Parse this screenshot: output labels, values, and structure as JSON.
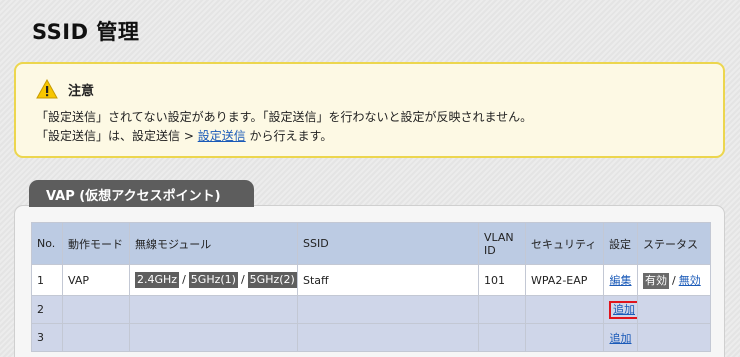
{
  "page": {
    "title": "SSID 管理"
  },
  "notice": {
    "title": "注意",
    "line1": "「設定送信」されてない設定があります。「設定送信」を行わないと設定が反映されません。",
    "line2_prefix": "「設定送信」は、設定送信 > ",
    "line2_link": "設定送信",
    "line2_suffix": " から行えます。",
    "icon": "warning-icon",
    "colors": {
      "background": "#fdf9e4",
      "border": "#ecd64e"
    }
  },
  "vap": {
    "tab_label": "VAP (仮想アクセスポイント)",
    "columns": [
      "No.",
      "動作モード",
      "無線モジュール",
      "SSID",
      "VLAN ID",
      "セキュリティ",
      "設定",
      "ステータス"
    ],
    "columns_vlan": [
      "VLAN",
      "ID"
    ],
    "rows": [
      {
        "no": "1",
        "mode": "VAP",
        "modules": [
          "2.4GHz",
          "5GHz(1)",
          "5GHz(2)"
        ],
        "ssid": "Staff",
        "vlan_id": "101",
        "security": "WPA2-EAP",
        "setting_link": "編集",
        "status_active": "有効",
        "status_link": "無効"
      },
      {
        "no": "2",
        "setting_link": "追加",
        "highlighted": true
      },
      {
        "no": "3",
        "setting_link": "追加"
      }
    ],
    "colors": {
      "header": "#bccbe3",
      "row_alt": "#cfd6e9",
      "tab": "#5d5d5d",
      "highlight": "#e0141c"
    }
  }
}
